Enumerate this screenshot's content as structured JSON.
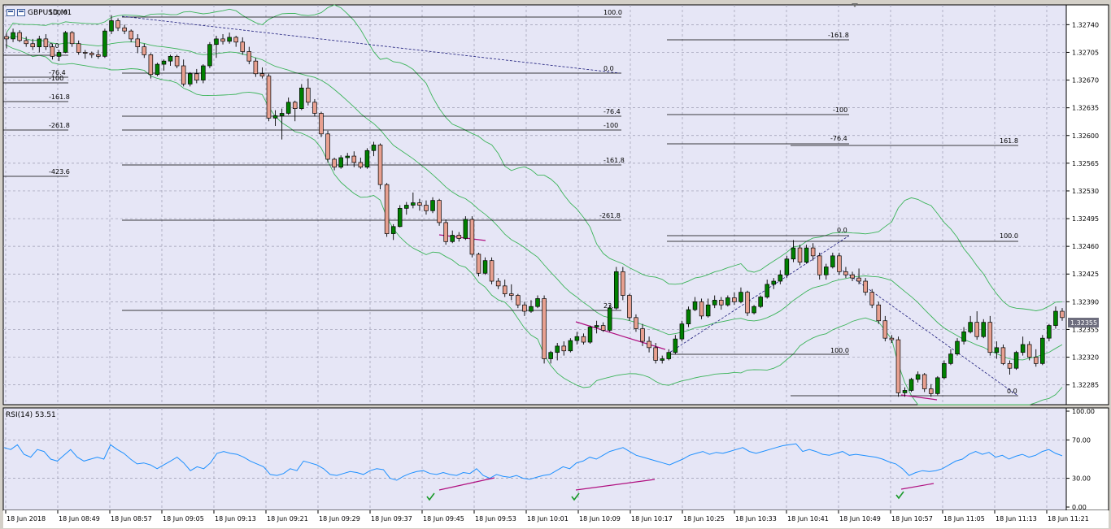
{
  "window": {
    "title": "GBPUSD,M1",
    "rsi_label": "RSI(14) 53.51",
    "current_price_label": "1.32355"
  },
  "colors": {
    "background": "#e6e6f6",
    "grid": "#9a9ab0",
    "bull_body": "#008000",
    "bear_body": "#e8a090",
    "bollinger": "#3cb45a",
    "rsi_line": "#1e90ff",
    "divergence": "#b01080",
    "fib_lines": "#000000",
    "trend_dash": "#1a1a7a"
  },
  "chart_data": [
    {
      "type": "candlestick",
      "symbol": "GBPUSD",
      "timeframe": "M1",
      "ylim": [
        1.3226,
        1.32765
      ],
      "y_ticks": [
        "1.32740",
        "1.32705",
        "1.32670",
        "1.32635",
        "1.32600",
        "1.32565",
        "1.32530",
        "1.32495",
        "1.32460",
        "1.32425",
        "1.32390",
        "1.32355",
        "1.32320",
        "1.32285"
      ],
      "x_ticks": [
        "18 Jun 2018",
        "18 Jun 08:49",
        "18 Jun 08:57",
        "18 Jun 09:05",
        "18 Jun 09:13",
        "18 Jun 09:21",
        "18 Jun 09:29",
        "18 Jun 09:37",
        "18 Jun 09:45",
        "18 Jun 09:53",
        "18 Jun 10:01",
        "18 Jun 10:09",
        "18 Jun 10:17",
        "18 Jun 10:25",
        "18 Jun 10:33",
        "18 Jun 10:41",
        "18 Jun 10:49",
        "18 Jun 10:57",
        "18 Jun 11:05",
        "18 Jun 11:13",
        "18 Jun 11:21"
      ],
      "current_price": 1.32355,
      "candles_ohlc": [
        [
          1.32725,
          1.3273,
          1.3271,
          1.32722
        ],
        [
          1.32722,
          1.32735,
          1.32718,
          1.3273
        ],
        [
          1.3273,
          1.32733,
          1.32718,
          1.3272
        ],
        [
          1.3272,
          1.32725,
          1.32712,
          1.32716
        ],
        [
          1.32716,
          1.32722,
          1.32708,
          1.32712
        ],
        [
          1.32712,
          1.32726,
          1.32705,
          1.32722
        ],
        [
          1.32722,
          1.32728,
          1.32708,
          1.32712
        ],
        [
          1.32712,
          1.32716,
          1.32696,
          1.327
        ],
        [
          1.327,
          1.32708,
          1.32694,
          1.32705
        ],
        [
          1.32705,
          1.32732,
          1.32704,
          1.3273
        ],
        [
          1.3273,
          1.32732,
          1.32712,
          1.32716
        ],
        [
          1.32716,
          1.3272,
          1.32702,
          1.32705
        ],
        [
          1.32705,
          1.32708,
          1.32697,
          1.32704
        ],
        [
          1.32704,
          1.32706,
          1.32698,
          1.32702
        ],
        [
          1.32702,
          1.32708,
          1.32697,
          1.327
        ],
        [
          1.327,
          1.32735,
          1.32698,
          1.32732
        ],
        [
          1.32732,
          1.32752,
          1.32728,
          1.32745
        ],
        [
          1.32745,
          1.32748,
          1.32732,
          1.32736
        ],
        [
          1.32736,
          1.3274,
          1.32728,
          1.32732
        ],
        [
          1.32732,
          1.32734,
          1.32718,
          1.32722
        ],
        [
          1.32722,
          1.32728,
          1.32704,
          1.32712
        ],
        [
          1.32712,
          1.32716,
          1.32698,
          1.32702
        ],
        [
          1.32702,
          1.32704,
          1.32672,
          1.32677
        ],
        [
          1.32677,
          1.32692,
          1.32675,
          1.3269
        ],
        [
          1.3269,
          1.32696,
          1.32682,
          1.32694
        ],
        [
          1.32694,
          1.32702,
          1.32688,
          1.327
        ],
        [
          1.327,
          1.32702,
          1.32685,
          1.32688
        ],
        [
          1.32688,
          1.32696,
          1.32662,
          1.32665
        ],
        [
          1.32665,
          1.3268,
          1.32662,
          1.32678
        ],
        [
          1.32678,
          1.32684,
          1.32666,
          1.3267
        ],
        [
          1.3267,
          1.3269,
          1.32666,
          1.32688
        ],
        [
          1.32688,
          1.32718,
          1.32685,
          1.32715
        ],
        [
          1.32715,
          1.32726,
          1.32698,
          1.32722
        ],
        [
          1.32722,
          1.32728,
          1.32715,
          1.32719
        ],
        [
          1.32719,
          1.3273,
          1.32716,
          1.32724
        ],
        [
          1.32724,
          1.32726,
          1.32712,
          1.32718
        ],
        [
          1.32718,
          1.32724,
          1.32702,
          1.32706
        ],
        [
          1.32706,
          1.32712,
          1.3269,
          1.32694
        ],
        [
          1.32694,
          1.32698,
          1.32674,
          1.32678
        ],
        [
          1.32678,
          1.32686,
          1.32672,
          1.32675
        ],
        [
          1.32675,
          1.32678,
          1.32618,
          1.32622
        ],
        [
          1.32622,
          1.32632,
          1.32612,
          1.32625
        ],
        [
          1.32625,
          1.32634,
          1.32595,
          1.32628
        ],
        [
          1.32628,
          1.32648,
          1.32626,
          1.32642
        ],
        [
          1.32642,
          1.32644,
          1.32618,
          1.32634
        ],
        [
          1.32634,
          1.32665,
          1.32632,
          1.3266
        ],
        [
          1.3266,
          1.32672,
          1.32638,
          1.32642
        ],
        [
          1.32642,
          1.32646,
          1.32624,
          1.32628
        ],
        [
          1.32628,
          1.3263,
          1.32598,
          1.32602
        ],
        [
          1.32602,
          1.32606,
          1.32566,
          1.3257
        ],
        [
          1.3257,
          1.32572,
          1.32556,
          1.3256
        ],
        [
          1.3256,
          1.32575,
          1.32558,
          1.32572
        ],
        [
          1.32572,
          1.32578,
          1.32562,
          1.32574
        ],
        [
          1.32574,
          1.3258,
          1.3256,
          1.32566
        ],
        [
          1.32566,
          1.32572,
          1.32558,
          1.3256
        ],
        [
          1.3256,
          1.32584,
          1.32558,
          1.32581
        ],
        [
          1.32581,
          1.32592,
          1.32574,
          1.32588
        ],
        [
          1.32588,
          1.3259,
          1.32532,
          1.32538
        ],
        [
          1.32538,
          1.3254,
          1.32472,
          1.32476
        ],
        [
          1.32476,
          1.32488,
          1.32468,
          1.32485
        ],
        [
          1.32485,
          1.32512,
          1.32484,
          1.32508
        ],
        [
          1.32508,
          1.32516,
          1.325,
          1.32512
        ],
        [
          1.32512,
          1.32528,
          1.32508,
          1.32515
        ],
        [
          1.32515,
          1.3252,
          1.32505,
          1.32512
        ],
        [
          1.32512,
          1.32518,
          1.325,
          1.32505
        ],
        [
          1.32505,
          1.32522,
          1.32502,
          1.32518
        ],
        [
          1.32518,
          1.3252,
          1.32486,
          1.3249
        ],
        [
          1.3249,
          1.32494,
          1.32462,
          1.32466
        ],
        [
          1.32466,
          1.3248,
          1.32464,
          1.32474
        ],
        [
          1.32474,
          1.32478,
          1.32466,
          1.3247
        ],
        [
          1.3247,
          1.32498,
          1.32468,
          1.32494
        ],
        [
          1.32494,
          1.32498,
          1.32446,
          1.3245
        ],
        [
          1.3245,
          1.32452,
          1.32422,
          1.32426
        ],
        [
          1.32426,
          1.32446,
          1.32424,
          1.32442
        ],
        [
          1.32442,
          1.32446,
          1.32412,
          1.32416
        ],
        [
          1.32416,
          1.3242,
          1.32406,
          1.3241
        ],
        [
          1.3241,
          1.32418,
          1.32396,
          1.324
        ],
        [
          1.324,
          1.32412,
          1.32392,
          1.32398
        ],
        [
          1.32398,
          1.324,
          1.32382,
          1.32386
        ],
        [
          1.32386,
          1.3239,
          1.32372,
          1.32378
        ],
        [
          1.32378,
          1.32392,
          1.32376,
          1.32384
        ],
        [
          1.32384,
          1.32398,
          1.32382,
          1.32394
        ],
        [
          1.32394,
          1.32398,
          1.32312,
          1.32318
        ],
        [
          1.32318,
          1.32328,
          1.32312,
          1.32326
        ],
        [
          1.32326,
          1.32338,
          1.32316,
          1.32334
        ],
        [
          1.32334,
          1.3234,
          1.32322,
          1.32328
        ],
        [
          1.32328,
          1.32344,
          1.32326,
          1.32341
        ],
        [
          1.32341,
          1.32352,
          1.32336,
          1.32346
        ],
        [
          1.32346,
          1.3235,
          1.32336,
          1.32339
        ],
        [
          1.32339,
          1.3236,
          1.32337,
          1.32358
        ],
        [
          1.32358,
          1.32366,
          1.3235,
          1.3236
        ],
        [
          1.3236,
          1.32364,
          1.32352,
          1.32354
        ],
        [
          1.32354,
          1.32386,
          1.32352,
          1.32382
        ],
        [
          1.32382,
          1.32434,
          1.3238,
          1.32428
        ],
        [
          1.32428,
          1.32434,
          1.32392,
          1.32398
        ],
        [
          1.32398,
          1.324,
          1.32366,
          1.3237
        ],
        [
          1.3237,
          1.32374,
          1.32352,
          1.32356
        ],
        [
          1.32356,
          1.32362,
          1.32334,
          1.3234
        ],
        [
          1.3234,
          1.32346,
          1.32326,
          1.32332
        ],
        [
          1.32332,
          1.32338,
          1.32312,
          1.32316
        ],
        [
          1.32316,
          1.32322,
          1.32312,
          1.32318
        ],
        [
          1.32318,
          1.3233,
          1.32316,
          1.32326
        ],
        [
          1.32326,
          1.32348,
          1.32324,
          1.32343
        ],
        [
          1.32343,
          1.32366,
          1.3234,
          1.32362
        ],
        [
          1.32362,
          1.32384,
          1.32358,
          1.3238
        ],
        [
          1.3238,
          1.32396,
          1.32378,
          1.3239
        ],
        [
          1.3239,
          1.32394,
          1.32368,
          1.32372
        ],
        [
          1.32372,
          1.32394,
          1.3237,
          1.32386
        ],
        [
          1.32386,
          1.32398,
          1.32382,
          1.32392
        ],
        [
          1.32392,
          1.32396,
          1.3238,
          1.32386
        ],
        [
          1.32386,
          1.32398,
          1.32384,
          1.32395
        ],
        [
          1.32395,
          1.32402,
          1.32386,
          1.3239
        ],
        [
          1.3239,
          1.32408,
          1.32388,
          1.32402
        ],
        [
          1.32402,
          1.32404,
          1.32372,
          1.32376
        ],
        [
          1.32376,
          1.32386,
          1.32374,
          1.32384
        ],
        [
          1.32384,
          1.32398,
          1.32382,
          1.32396
        ],
        [
          1.32396,
          1.32418,
          1.32394,
          1.32412
        ],
        [
          1.32412,
          1.3242,
          1.32406,
          1.32416
        ],
        [
          1.32416,
          1.3243,
          1.32412,
          1.32424
        ],
        [
          1.32424,
          1.32448,
          1.3242,
          1.32444
        ],
        [
          1.32444,
          1.32468,
          1.3244,
          1.32458
        ],
        [
          1.32458,
          1.32462,
          1.32436,
          1.3244
        ],
        [
          1.3244,
          1.32462,
          1.32438,
          1.32458
        ],
        [
          1.32458,
          1.32464,
          1.32442,
          1.32448
        ],
        [
          1.32448,
          1.32452,
          1.32418,
          1.32424
        ],
        [
          1.32424,
          1.32438,
          1.32418,
          1.32434
        ],
        [
          1.32434,
          1.32452,
          1.32432,
          1.32448
        ],
        [
          1.32448,
          1.32452,
          1.32424,
          1.32428
        ],
        [
          1.32428,
          1.32434,
          1.3242,
          1.32424
        ],
        [
          1.32424,
          1.32428,
          1.32416,
          1.3242
        ],
        [
          1.3242,
          1.32432,
          1.32412,
          1.32416
        ],
        [
          1.32416,
          1.3242,
          1.32398,
          1.32402
        ],
        [
          1.32402,
          1.32406,
          1.32382,
          1.32386
        ],
        [
          1.32386,
          1.3239,
          1.32362,
          1.32366
        ],
        [
          1.32366,
          1.32372,
          1.3234,
          1.32344
        ],
        [
          1.32344,
          1.32348,
          1.32338,
          1.32342
        ],
        [
          1.32342,
          1.32346,
          1.3227,
          1.32275
        ],
        [
          1.32275,
          1.32282,
          1.3227,
          1.32278
        ],
        [
          1.32278,
          1.32294,
          1.32276,
          1.32292
        ],
        [
          1.32292,
          1.32302,
          1.32288,
          1.32298
        ],
        [
          1.32298,
          1.323,
          1.32276,
          1.3228
        ],
        [
          1.3228,
          1.32286,
          1.3227,
          1.32274
        ],
        [
          1.32274,
          1.32296,
          1.32272,
          1.32294
        ],
        [
          1.32294,
          1.32316,
          1.32292,
          1.32312
        ],
        [
          1.32312,
          1.3233,
          1.3231,
          1.32324
        ],
        [
          1.32324,
          1.32344,
          1.32322,
          1.3234
        ],
        [
          1.3234,
          1.32358,
          1.32336,
          1.32352
        ],
        [
          1.32352,
          1.32372,
          1.3235,
          1.32364
        ],
        [
          1.32364,
          1.32378,
          1.32342,
          1.32346
        ],
        [
          1.32346,
          1.32368,
          1.32344,
          1.32364
        ],
        [
          1.32364,
          1.32372,
          1.32322,
          1.32326
        ],
        [
          1.32326,
          1.3234,
          1.32318,
          1.32332
        ],
        [
          1.32332,
          1.32336,
          1.3231,
          1.32312
        ],
        [
          1.32312,
          1.32316,
          1.32298,
          1.32306
        ],
        [
          1.32306,
          1.32328,
          1.32304,
          1.32326
        ],
        [
          1.32326,
          1.32346,
          1.32322,
          1.32336
        ],
        [
          1.32336,
          1.3234,
          1.32316,
          1.3232
        ],
        [
          1.3232,
          1.3233,
          1.32308,
          1.32312
        ],
        [
          1.32312,
          1.32348,
          1.3231,
          1.32344
        ],
        [
          1.32344,
          1.32362,
          1.3234,
          1.3236
        ],
        [
          1.3236,
          1.32384,
          1.32356,
          1.32378
        ],
        [
          1.32378,
          1.32382,
          1.32366,
          1.3237
        ]
      ]
    },
    {
      "type": "line",
      "name": "RSI(14)",
      "value": 53.51,
      "ylim": [
        0,
        100
      ],
      "y_ticks": [
        "100.00",
        "70.00",
        "30.00",
        "0.00"
      ],
      "values": [
        62,
        60,
        65,
        55,
        52,
        60,
        58,
        50,
        48,
        54,
        60,
        52,
        48,
        50,
        52,
        50,
        65,
        60,
        56,
        50,
        45,
        46,
        44,
        40,
        44,
        48,
        52,
        46,
        38,
        42,
        40,
        46,
        56,
        58,
        56,
        55,
        52,
        48,
        45,
        42,
        34,
        33,
        35,
        40,
        38,
        48,
        46,
        44,
        40,
        34,
        33,
        35,
        37,
        36,
        34,
        38,
        40,
        39,
        30,
        28,
        32,
        35,
        37,
        38,
        35,
        34,
        36,
        34,
        33,
        36,
        35,
        40,
        33,
        30,
        34,
        32,
        31,
        33,
        30,
        29,
        31,
        33,
        34,
        38,
        42,
        40,
        46,
        48,
        52,
        50,
        54,
        58,
        60,
        62,
        58,
        54,
        52,
        50,
        48,
        46,
        44,
        47,
        50,
        54,
        56,
        58,
        55,
        57,
        56,
        58,
        60,
        62,
        58,
        56,
        58,
        60,
        62,
        64,
        65,
        66,
        58,
        60,
        58,
        55,
        54,
        56,
        58,
        54,
        55,
        54,
        53,
        52,
        50,
        47,
        45,
        40,
        33,
        36,
        38,
        37,
        38,
        40,
        44,
        48,
        50,
        55,
        58,
        55,
        57,
        52,
        54,
        50,
        53,
        55,
        52,
        54,
        58,
        60,
        56,
        53.51
      ]
    }
  ],
  "fib_labels": {
    "left_upper": [
      "100.0",
      "0.0",
      "-76.4",
      "-100",
      "-161.8",
      "-261.8",
      "-423.6"
    ],
    "left_mid": [
      "100.0",
      "0.0",
      "-76.4",
      "-100",
      "-161.8",
      "-261.8",
      "23.6"
    ],
    "right_upper": [
      "-161.8",
      "-100",
      "-76.4",
      "161.8"
    ],
    "right_lower": [
      "0.0",
      "100.0",
      "100.0",
      "0.0"
    ]
  }
}
